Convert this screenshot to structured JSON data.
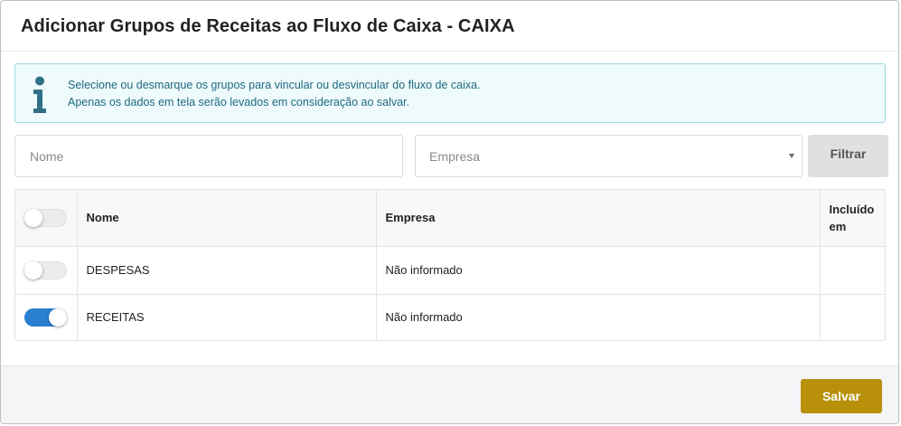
{
  "modal": {
    "title": "Adicionar Grupos de Receitas ao Fluxo de Caixa - CAIXA"
  },
  "info": {
    "icon": "info-icon",
    "line1": "Selecione ou desmarque os grupos para vincular ou desvincular do fluxo de caixa.",
    "line2": "Apenas os dados em tela serão levados em consideração ao salvar.",
    "text_color": "#1f6a82",
    "background": "#eefafb"
  },
  "filters": {
    "nome_placeholder": "Nome",
    "nome_value": "",
    "empresa_selected": "Empresa",
    "filter_button": "Filtrar"
  },
  "table": {
    "headers": {
      "nome": "Nome",
      "empresa": "Empresa",
      "incluido": "Incluído em"
    },
    "select_all_checked": false,
    "rows": [
      {
        "nome": "DESPESAS",
        "empresa": "Não informado",
        "incluido": "",
        "checked": false
      },
      {
        "nome": "RECEITAS",
        "empresa": "Não informado",
        "incluido": "",
        "checked": true
      }
    ]
  },
  "footer": {
    "save_button": "Salvar",
    "save_color": "#b8900a"
  },
  "colors": {
    "toggle_on": "#2a7fcf"
  }
}
